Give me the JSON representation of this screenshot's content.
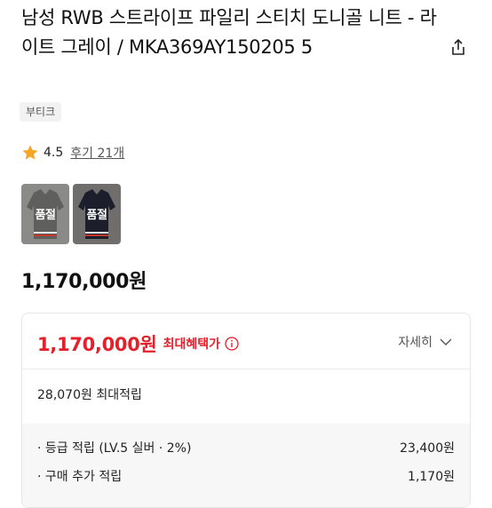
{
  "product": {
    "title": "남성 RWB 스트라이프 파일리 스티치 도니골 니트 - 라이트 그레이 / MKA369AY150205 5",
    "badge": "부티크",
    "rating": "4.5",
    "review_link": "후기 21개",
    "options": [
      {
        "label": "품절"
      },
      {
        "label": "품절"
      }
    ],
    "price": "1,170,000원"
  },
  "benefit": {
    "price": "1,170,000원",
    "max_label": "최대혜택가",
    "detail_toggle": "자세히",
    "points_total": "28,070원 최대적립",
    "rows": [
      {
        "label": "· 등급 적립 (LV.5 실버 · 2%)",
        "value": "23,400원"
      },
      {
        "label": "· 구매 추가 적립",
        "value": "1,170원"
      }
    ]
  },
  "colors": {
    "accent_red": "#e4202b",
    "star": "#f5a623"
  },
  "icons": [
    "share-icon",
    "star-icon",
    "info-icon",
    "chevron-down-icon"
  ]
}
